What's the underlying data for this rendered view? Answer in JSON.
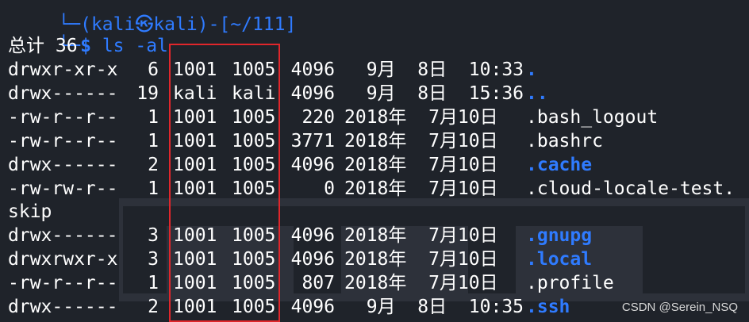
{
  "prompt": {
    "header_text": "(kali㉿kali)-[~/111]",
    "dollar": "$",
    "command": "ls -al"
  },
  "total_line": "总计 36",
  "entries": [
    {
      "perm": "drwxr-xr-x",
      "links": "6",
      "owner": "1001",
      "group": "1005",
      "size": "4096",
      "date": "  9月  8日  10:33",
      "name": ".",
      "is_dir": true
    },
    {
      "perm": "drwx------",
      "links": "19",
      "owner": "kali",
      "group": "kali",
      "size": "4096",
      "date": "  9月  8日  15:36",
      "name": "..",
      "is_dir": true
    },
    {
      "perm": "-rw-r--r--",
      "links": "1",
      "owner": "1001",
      "group": "1005",
      "size": "220",
      "date": "2018年  7月10日",
      "name": ".bash_logout",
      "is_dir": false
    },
    {
      "perm": "-rw-r--r--",
      "links": "1",
      "owner": "1001",
      "group": "1005",
      "size": "3771",
      "date": "2018年  7月10日",
      "name": ".bashrc",
      "is_dir": false
    },
    {
      "perm": "drwx------",
      "links": "2",
      "owner": "1001",
      "group": "1005",
      "size": "4096",
      "date": "2018年  7月10日",
      "name": ".cache",
      "is_dir": true
    },
    {
      "perm": "-rw-rw-r--",
      "links": "1",
      "owner": "1001",
      "group": "1005",
      "size": "0",
      "date": "2018年  7月10日",
      "name": ".cloud-locale-test.",
      "is_dir": false
    },
    {
      "perm": "drwx------",
      "links": "3",
      "owner": "1001",
      "group": "1005",
      "size": "4096",
      "date": "2018年  7月10日",
      "name": ".gnupg",
      "is_dir": true
    },
    {
      "perm": "drwxrwxr-x",
      "links": "3",
      "owner": "1001",
      "group": "1005",
      "size": "4096",
      "date": "2018年  7月10日",
      "name": ".local",
      "is_dir": true
    },
    {
      "perm": "-rw-r--r--",
      "links": "1",
      "owner": "1001",
      "group": "1005",
      "size": "807",
      "date": "2018年  7月10日",
      "name": ".profile",
      "is_dir": false
    },
    {
      "perm": "drwx------",
      "links": "2",
      "owner": "1001",
      "group": "1005",
      "size": "4096",
      "date": "  9月  8日  10:35",
      "name": ".ssh",
      "is_dir": true
    }
  ],
  "wrap_text": "skip",
  "watermark": "CSDN @Serein_NSQ",
  "colors": {
    "background": "#1f232a",
    "directory": "#2f7bff",
    "highlight_box": "#e0262b"
  }
}
